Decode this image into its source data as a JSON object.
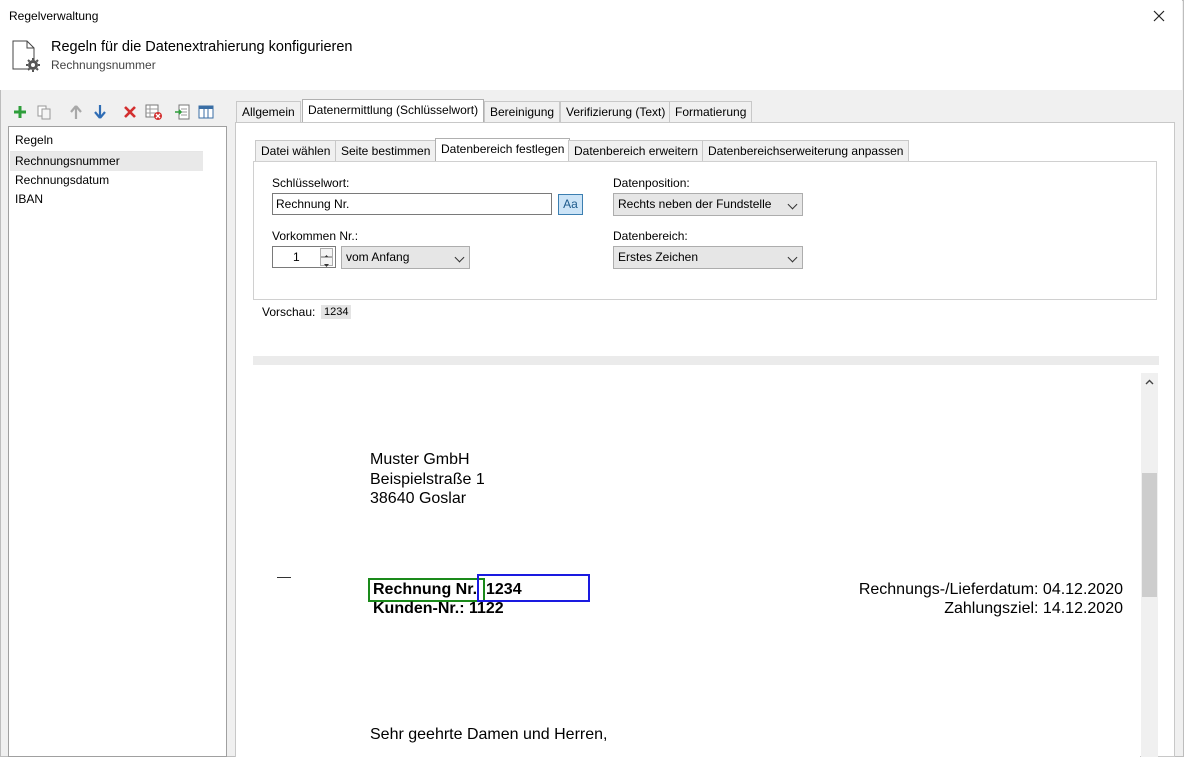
{
  "window": {
    "title": "Regelverwaltung"
  },
  "header": {
    "title": "Regeln für die Datenextrahierung konfigurieren",
    "subtitle": "Rechnungsnummer"
  },
  "rules": {
    "header": "Regeln",
    "items": [
      "Rechnungsnummer",
      "Rechnungsdatum",
      "IBAN"
    ]
  },
  "main_tabs": [
    "Allgemein",
    "Datenermittlung (Schlüsselwort)",
    "Bereinigung",
    "Verifizierung (Text)",
    "Formatierung"
  ],
  "sub_tabs": [
    "Datei wählen",
    "Seite bestimmen",
    "Datenbereich festlegen",
    "Datenbereich erweitern",
    "Datenbereichserweiterung anpassen"
  ],
  "form": {
    "keyword_label": "Schlüsselwort:",
    "keyword_value": "Rechnung Nr.",
    "case_button": "Aa",
    "occurrence_label": "Vorkommen Nr.:",
    "occurrence_value": "1",
    "occurrence_direction": "vom Anfang",
    "position_label": "Datenposition:",
    "position_value": "Rechts neben der Fundstelle",
    "range_label": "Datenbereich:",
    "range_value": "Erstes Zeichen"
  },
  "preview": {
    "label": "Vorschau:",
    "value": "1234"
  },
  "document": {
    "address": [
      "Muster GmbH",
      "Beispielstraße 1",
      "38640 Goslar"
    ],
    "invoice_label": "Rechnung Nr.",
    "invoice_value": "1234",
    "customer_line": "Kunden-Nr.: 1122",
    "date_line": "Rechnungs-/Lieferdatum: 04.12.2020",
    "due_line": "Zahlungsziel: 14.12.2020",
    "greeting": "Sehr geehrte Damen und Herren,"
  },
  "colors": {
    "keyword_box": "#1a8a1a",
    "value_box": "#1a1ae0",
    "accent": "#3c7fb1"
  }
}
